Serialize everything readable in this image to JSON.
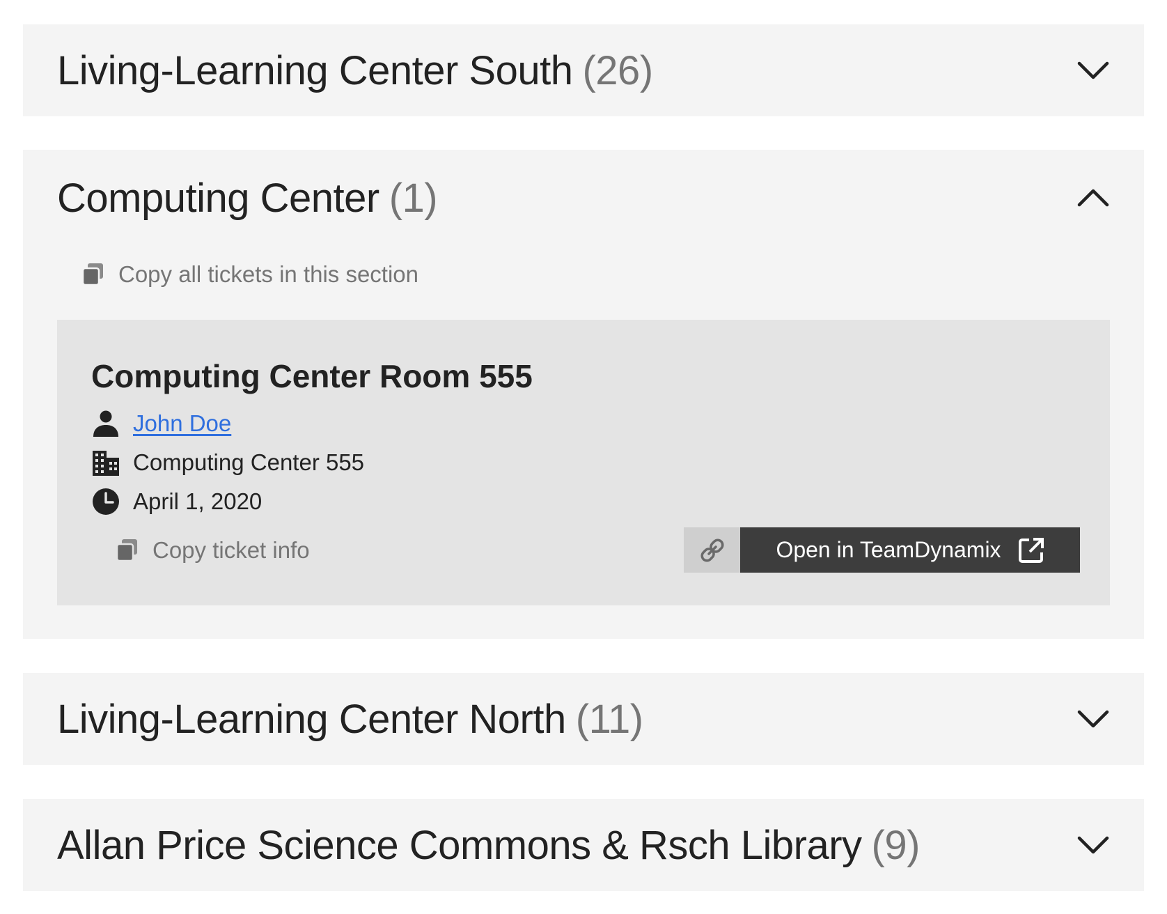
{
  "sections": [
    {
      "name": "Living-Learning Center South",
      "count": "(26)",
      "expanded": false,
      "toggle_icon": "chevron-down-icon"
    },
    {
      "name": "Computing Center",
      "count": "(1)",
      "expanded": true,
      "toggle_icon": "chevron-up-icon",
      "copy_all_label": "Copy all tickets in this section",
      "copy_all_icon": "copy-icon",
      "tickets": [
        {
          "title": "Computing Center Room 555",
          "person": "John Doe",
          "person_icon": "person-icon",
          "location": "Computing Center 555",
          "location_icon": "building-icon",
          "date": "April 1, 2020",
          "date_icon": "clock-icon",
          "copy_label": "Copy ticket info",
          "copy_icon": "copy-icon",
          "link_icon": "link-icon",
          "open_label": "Open in TeamDynamix",
          "open_icon": "external-link-icon"
        }
      ]
    },
    {
      "name": "Living-Learning Center North",
      "count": "(11)",
      "expanded": false,
      "toggle_icon": "chevron-down-icon"
    },
    {
      "name": "Allan Price Science Commons & Rsch Library",
      "count": "(9)",
      "expanded": false,
      "toggle_icon": "chevron-down-icon"
    }
  ],
  "colors": {
    "section_bg": "#f4f4f4",
    "card_bg": "#e4e4e4",
    "count_text": "#757575",
    "link_text": "#2f6fde",
    "primary_button_bg": "#3d3d3d",
    "secondary_button_bg": "#cfcfcf"
  }
}
